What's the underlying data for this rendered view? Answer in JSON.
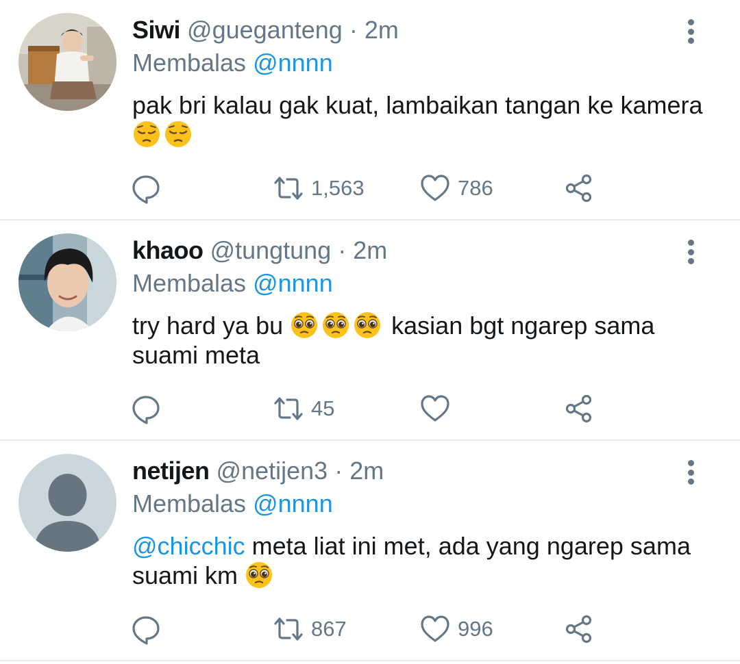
{
  "tweets": [
    {
      "name": "Siwi",
      "handle": "@gueganteng",
      "dot": "·",
      "time": "2m",
      "reply_prefix": "Membalas",
      "reply_to": "@nnnn",
      "text": "pak bri kalau gak kuat, lambaikan tangan ke kamera",
      "body_emojis": [
        "pensive-face-emoji",
        "pensive-face-emoji"
      ],
      "retweets": "1,563",
      "likes": "786"
    },
    {
      "name": "khaoo",
      "handle": "@tungtung",
      "dot": "·",
      "time": "2m",
      "reply_prefix": "Membalas",
      "reply_to": "@nnnn",
      "text_before": "try hard ya bu",
      "text_after": "kasian bgt ngarep sama suami meta",
      "body_emojis": [
        "pleading-face-emoji",
        "pleading-face-emoji",
        "pleading-face-emoji"
      ],
      "retweets": "45",
      "likes": ""
    },
    {
      "name": "netijen",
      "handle": "@netijen3",
      "dot": "·",
      "time": "2m",
      "reply_prefix": "Membalas",
      "reply_to": "@nnnn",
      "mention": "@chicchic",
      "text": "meta liat ini met, ada yang ngarep sama suami km",
      "body_emojis": [
        "pleading-face-emoji"
      ],
      "retweets": "867",
      "likes": "996"
    }
  ],
  "icons": {
    "reply": "reply-bubble-icon",
    "retweet": "retweet-icon",
    "like": "heart-icon",
    "share": "share-icon",
    "more": "more-vertical-icon"
  },
  "colors": {
    "text_primary": "#14171a",
    "text_secondary": "#657786",
    "link": "#1b95e0",
    "divider": "#e6ecf0"
  }
}
